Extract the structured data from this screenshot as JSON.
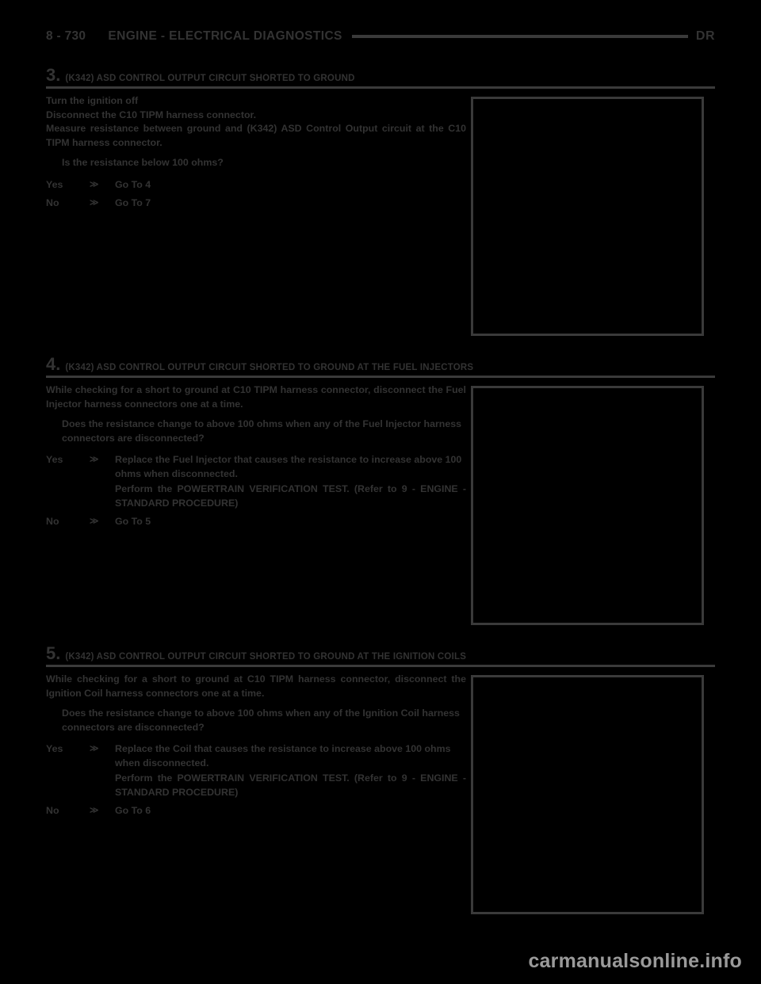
{
  "header": {
    "folio": "8 - 730",
    "title": "ENGINE - ELECTRICAL DIAGNOSTICS",
    "book": "DR"
  },
  "steps": [
    {
      "number": "3.",
      "title": "(K342) ASD CONTROL OUTPUT CIRCUIT SHORTED TO GROUND",
      "lines": [
        "Turn the ignition off",
        "Disconnect the C10 TIPM harness connector.",
        "Measure resistance between ground and (K342) ASD Control Output circuit at the C10 TIPM harness connector."
      ],
      "question": "Is the resistance below 100 ohms?",
      "answers": [
        {
          "label": "Yes",
          "arrow": "≫",
          "text": "Go To 4",
          "extra": ""
        },
        {
          "label": "No",
          "arrow": "≫",
          "text": "Go To 7",
          "extra": ""
        }
      ]
    },
    {
      "number": "4.",
      "title": "(K342) ASD CONTROL OUTPUT CIRCUIT SHORTED TO GROUND AT THE FUEL INJECTORS",
      "lines": [
        "While checking for a short to ground at C10 TIPM harness connector, disconnect the Fuel Injector harness connectors one at a time."
      ],
      "question": "Does the resistance change to above 100 ohms when any of the Fuel Injector harness connectors are disconnected?",
      "answers": [
        {
          "label": "Yes",
          "arrow": "≫",
          "text": "Replace the Fuel Injector that causes the resistance to increase above 100 ohms when disconnected.",
          "extra": "Perform the POWERTRAIN VERIFICATION TEST. (Refer to 9 - ENGINE - STANDARD PROCEDURE)"
        },
        {
          "label": "No",
          "arrow": "≫",
          "text": "Go To 5",
          "extra": ""
        }
      ]
    },
    {
      "number": "5.",
      "title": "(K342) ASD CONTROL OUTPUT CIRCUIT SHORTED TO GROUND AT THE IGNITION COILS",
      "lines": [
        "While checking for a short to ground at C10 TIPM harness connector, disconnect the Ignition Coil harness connectors one at a time."
      ],
      "question": "Does the resistance change to above 100 ohms when any of the Ignition Coil harness connectors are disconnected?",
      "answers": [
        {
          "label": "Yes",
          "arrow": "≫",
          "text": "Replace the Coil that causes the resistance to increase above 100 ohms when disconnected.",
          "extra": "Perform the POWERTRAIN VERIFICATION TEST. (Refer to 9 - ENGINE - STANDARD PROCEDURE)"
        },
        {
          "label": "No",
          "arrow": "≫",
          "text": "Go To 6",
          "extra": ""
        }
      ]
    }
  ],
  "footer": {
    "watermark": "carmanualsonline.info"
  }
}
